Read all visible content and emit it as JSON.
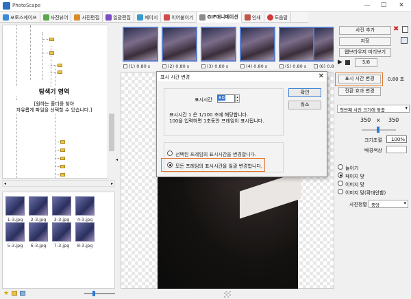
{
  "window": {
    "title": "PhotoScape",
    "minimize": "—",
    "maximize": "☐",
    "close": "✕"
  },
  "tabs": [
    {
      "label": "포토스케이프",
      "color": "#3a8ad9"
    },
    {
      "label": "사진뷰어",
      "color": "#59a84a"
    },
    {
      "label": "사진편집",
      "color": "#d98c2a"
    },
    {
      "label": "일괄편집",
      "color": "#7a4ec2"
    },
    {
      "label": "페이지",
      "color": "#3a9ad0"
    },
    {
      "label": "이어붙이기",
      "color": "#d24a4a"
    },
    {
      "label": "GIF애니메이션",
      "color": "#8a8a8a"
    },
    {
      "label": "인쇄",
      "color": "#c0564a"
    },
    {
      "label": "도움말",
      "color": "#d23a3a"
    }
  ],
  "explorer": {
    "heading": "탐색기 영역",
    "hint1": "[원하는 폴더를 찾아",
    "hint2": "자유롭게 파일을 선택할 수 있습니다.]"
  },
  "thumbnails": [
    "1-3.jpg",
    "2-3.jpg",
    "3-3.jpg",
    "4-3.jpg",
    "5-3.jpg",
    "6-3.jpg",
    "7-3.jpg",
    "8-3.jpg"
  ],
  "frames": [
    {
      "label": "(1) 0.80 s"
    },
    {
      "label": "(2) 0.80 s"
    },
    {
      "label": "(3) 0.80 s"
    },
    {
      "label": "(4) 0.80 s"
    },
    {
      "label": "(5) 0.80 s"
    },
    {
      "label": "(6) 0.80 s"
    }
  ],
  "dialog": {
    "title": "표시 시간 변경",
    "close": "✕",
    "time_label": "표시시간",
    "time_value": "80",
    "desc1": "표시시간 1 은 1/100 초에 해당합니다.",
    "desc2": "100을 입력하면 1초동안 프레임이 표시됩니다.",
    "ok": "확인",
    "cancel": "취소",
    "opt1": "선택된 프레임의 표시시간을 변경합니다.",
    "opt2": "모든 프레임의 표시시간을 일괄 변경합니다."
  },
  "right": {
    "add_photo": "사진 추가",
    "save": "저장",
    "browser_preview": "웹브라우저 미리보기",
    "frame_counter": "5/8",
    "change_time": "표시 시간 변경",
    "time_value": "0.80 초",
    "transition": "전환 효과 변경",
    "fit_select": "첫번째 사진 크기에 맞춤",
    "width": "350",
    "height": "350",
    "x": "x",
    "size_label": "크기조절",
    "size_value": "100%",
    "bg_label": "배경색상",
    "radio_stretch": "늘이기",
    "radio_fit_page": "페이지 맞",
    "radio_image": "이미지 맞",
    "radio_image_center": "이미지 맞(확대안함)",
    "align_label": "사진정렬",
    "align_value": "중앙"
  }
}
